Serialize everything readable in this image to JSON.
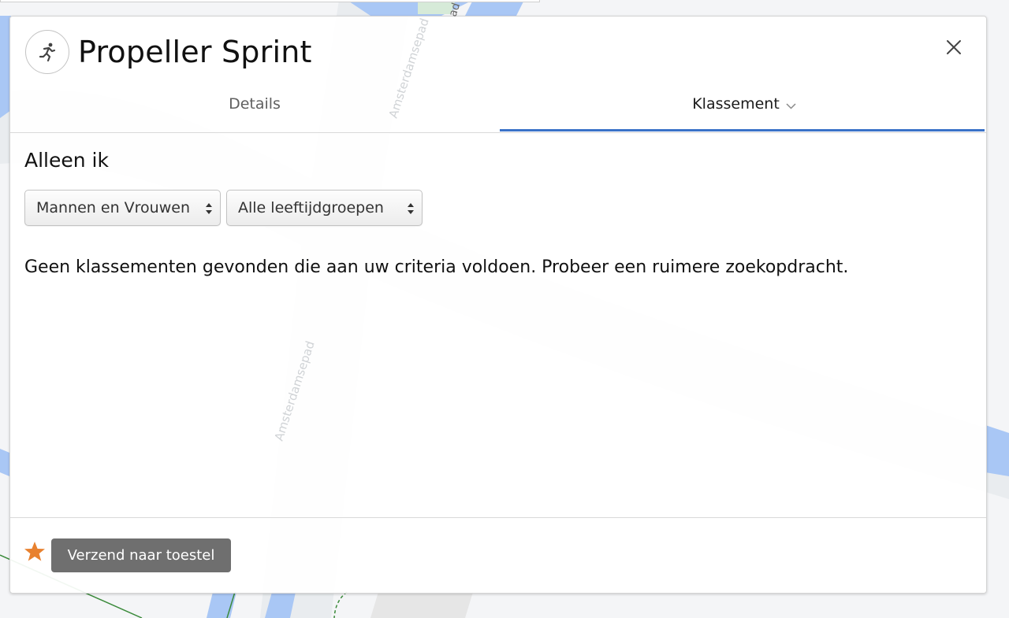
{
  "app": {
    "title": "Propeller Sprint",
    "icon": "runner-icon"
  },
  "tabs": [
    {
      "label": "Details",
      "active": false
    },
    {
      "label": "Klassement",
      "active": true
    }
  ],
  "content": {
    "section_title": "Alleen ik",
    "filters": {
      "gender_selected": "Mannen en Vrouwen",
      "age_selected": "Alle leeftijdgroepen"
    },
    "empty_message": "Geen klassementen gevonden die aan uw criteria voldoen. Probeer een ruimere zoekopdracht."
  },
  "footer": {
    "send_label": "Verzend naar toestel"
  },
  "map": {
    "street_labels": [
      "Amsterdamsepad",
      "Amsterdamsepad",
      "ad"
    ]
  },
  "colors": {
    "accent": "#3a72c8",
    "star": "#e8812f",
    "button": "#6f6f6f",
    "water": "#a9c7f5"
  }
}
